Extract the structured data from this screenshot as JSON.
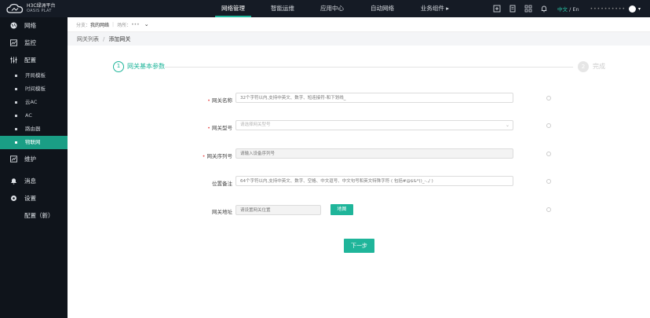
{
  "app": {
    "logo_line1": "H3C绿洲平台",
    "logo_line2": "OASIS PLAT"
  },
  "topnav": [
    {
      "label": "网络管理",
      "active": true
    },
    {
      "label": "智能运维",
      "active": false
    },
    {
      "label": "应用中心",
      "active": false
    },
    {
      "label": "自动网络",
      "active": false
    },
    {
      "label": "业务组件 ▸",
      "active": false
    }
  ],
  "header": {
    "lang_zh": "中文",
    "lang_sep": " / ",
    "lang_en": "En",
    "user_masked": "••••••••••"
  },
  "sidebar": {
    "items": [
      {
        "label": "网络",
        "icon": "globe-icon"
      },
      {
        "label": "监控",
        "icon": "monitor-icon"
      },
      {
        "label": "配置",
        "icon": "sliders-icon"
      }
    ],
    "sub_items": [
      {
        "label": "开局模板",
        "active": false
      },
      {
        "label": "时间模板",
        "active": false
      },
      {
        "label": "云AC",
        "active": false
      },
      {
        "label": "AC",
        "active": false
      },
      {
        "label": "路由器",
        "active": false
      },
      {
        "label": "物联网",
        "active": true
      }
    ],
    "items2": [
      {
        "label": "维护",
        "icon": "wrench-icon"
      },
      {
        "label": "消息",
        "icon": "bell-icon"
      },
      {
        "label": "设置",
        "icon": "gear-icon"
      },
      {
        "label": "配置（新）",
        "icon": ""
      }
    ]
  },
  "filter": {
    "branch_label": "分支：",
    "branch_value": "我的网络",
    "site_label": "场所：",
    "site_value": "•••"
  },
  "breadcrumb": {
    "parent": "网关列表",
    "separator": "/",
    "current": "添加网关"
  },
  "steps": [
    {
      "number": "1",
      "label": "网关基本参数",
      "active": true
    },
    {
      "number": "2",
      "label": "完成",
      "active": false
    }
  ],
  "form": {
    "gateway_name": {
      "label": "网关名称",
      "placeholder": "32个字符以内,支持中英文、数字、短连接符-和下划线_"
    },
    "gateway_model": {
      "label": "网关型号",
      "placeholder": "请选择网关型号"
    },
    "gateway_serial": {
      "label": "网关序列号",
      "placeholder": "请输入设备序列号"
    },
    "location_note": {
      "label": "位置备注",
      "placeholder": "64个字符以内,支持中英文、数字、空格、中文逗号、中文句号和英文特殊字符 ( 包括#@$&*()_-.,/ )"
    },
    "gateway_address": {
      "label": "网关地址",
      "placeholder": "请设置网关位置",
      "map_button": "地图"
    },
    "next_button": "下一步"
  },
  "colors": {
    "accent": "#1fb59a",
    "topbar_bg": "#151b25",
    "sidebar_bg": "#0f141b",
    "required": "#e84a4a"
  }
}
